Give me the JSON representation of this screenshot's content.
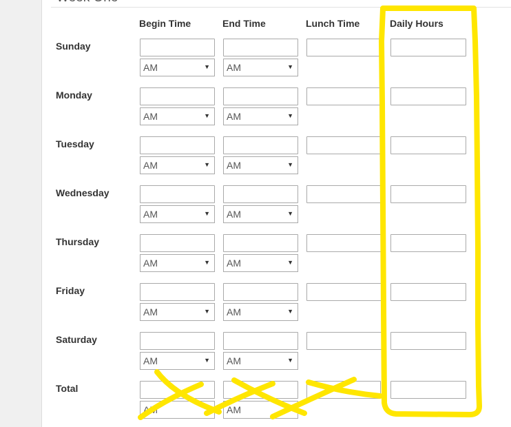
{
  "section": {
    "title": "Week One"
  },
  "columns": {
    "begin": "Begin Time",
    "end": "End Time",
    "lunch": "Lunch Time",
    "daily": "Daily Hours"
  },
  "rows": [
    {
      "label": "Sunday",
      "begin_period": "AM",
      "end_period": "AM"
    },
    {
      "label": "Monday",
      "begin_period": "AM",
      "end_period": "AM"
    },
    {
      "label": "Tuesday",
      "begin_period": "AM",
      "end_period": "AM"
    },
    {
      "label": "Wednesday",
      "begin_period": "AM",
      "end_period": "AM"
    },
    {
      "label": "Thursday",
      "begin_period": "AM",
      "end_period": "AM"
    },
    {
      "label": "Friday",
      "begin_period": "AM",
      "end_period": "AM"
    },
    {
      "label": "Saturday",
      "begin_period": "AM",
      "end_period": "AM"
    },
    {
      "label": "Total",
      "begin_period": "AM",
      "end_period": "AM"
    }
  ],
  "icons": {
    "dropdown": "caret-down-icon"
  },
  "annotation": {
    "highlight_color": "#ffe600"
  }
}
